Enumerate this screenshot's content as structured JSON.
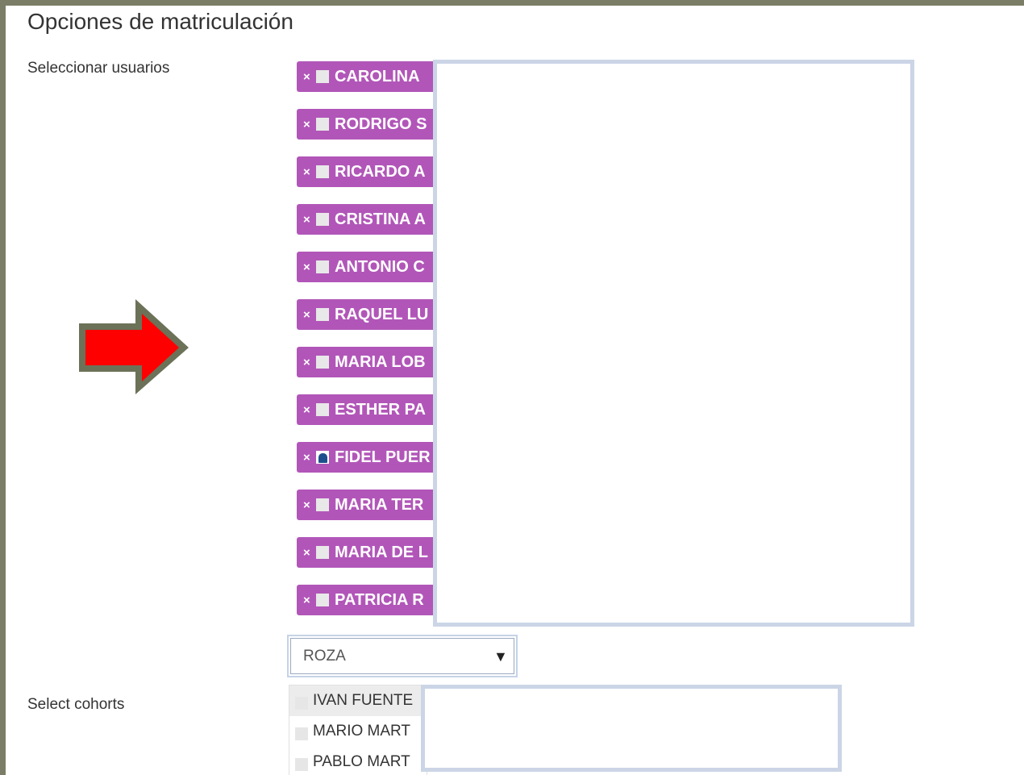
{
  "form": {
    "title": "Opciones de matriculación",
    "select_users_label": "Seleccionar usuarios",
    "select_cohorts_label": "Select cohorts"
  },
  "selected_users": [
    {
      "label": "CAROLINA",
      "remove": "×",
      "icon": "user-picture-icon"
    },
    {
      "label": "RODRIGO S",
      "remove": "×",
      "icon": "user-picture-icon"
    },
    {
      "label": "RICARDO A",
      "remove": "×",
      "icon": "user-picture-icon"
    },
    {
      "label": "CRISTINA A",
      "remove": "×",
      "icon": "user-picture-icon"
    },
    {
      "label": "ANTONIO C",
      "remove": "×",
      "icon": "user-picture-icon"
    },
    {
      "label": "RAQUEL LU",
      "remove": "×",
      "icon": "user-picture-icon"
    },
    {
      "label": "MARIA LOB",
      "remove": "×",
      "icon": "user-picture-icon"
    },
    {
      "label": "ESTHER PA",
      "remove": "×",
      "icon": "user-picture-icon"
    },
    {
      "label": "FIDEL PUER",
      "remove": "×",
      "icon": "user-photo-icon"
    },
    {
      "label": "MARIA TER",
      "remove": "×",
      "icon": "user-picture-icon"
    },
    {
      "label": "MARIA DE L",
      "remove": "×",
      "icon": "user-picture-icon"
    },
    {
      "label": "PATRICIA R",
      "remove": "×",
      "icon": "user-picture-icon"
    }
  ],
  "search": {
    "value": "ROZA",
    "caret": "▼"
  },
  "suggestions": [
    {
      "label": "IVAN FUENTE"
    },
    {
      "label": "MARIO MART"
    },
    {
      "label": "PABLO MART"
    }
  ],
  "colors": {
    "chip_background": "#b156b8",
    "arrow_fill": "#ff0000",
    "arrow_outline": "#6b7258",
    "redaction_border": "#cbd5e6",
    "frame_background": "#7b7d66"
  }
}
